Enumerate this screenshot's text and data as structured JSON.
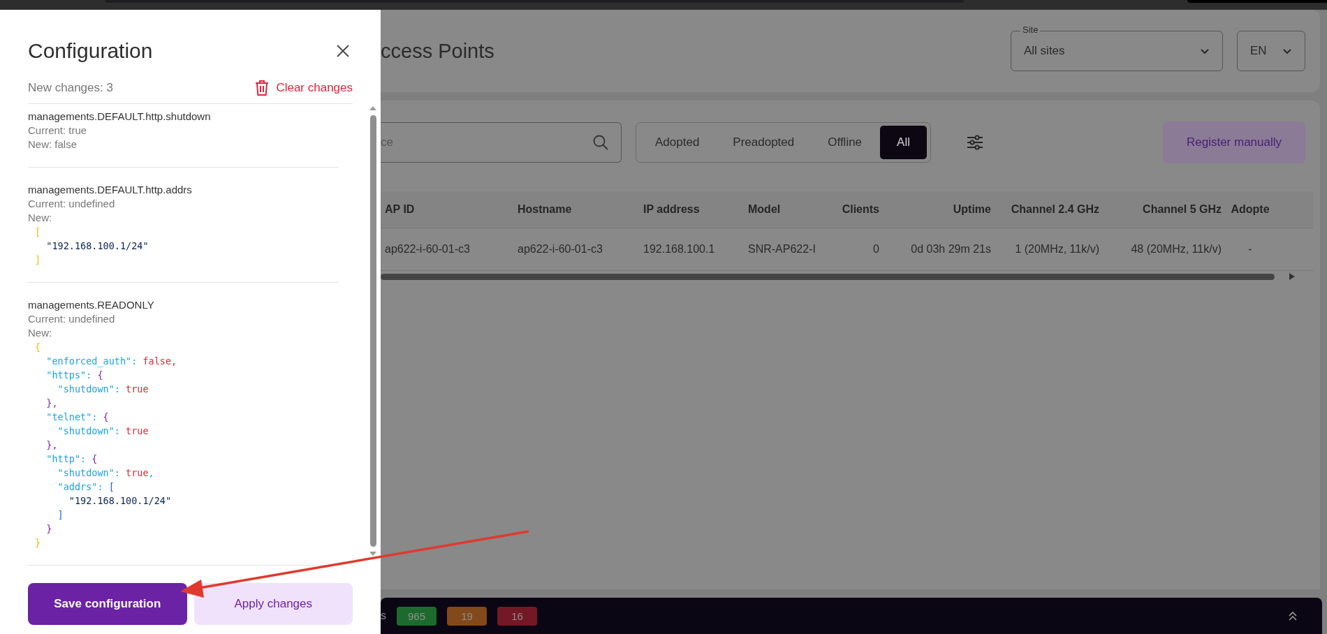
{
  "drawer": {
    "title": "Configuration",
    "new_changes": "New changes: 3",
    "clear": "Clear changes",
    "changes": [
      {
        "path": "managements.DEFAULT.http.shutdown",
        "current": "Current: true",
        "new": "New: false"
      },
      {
        "path": "managements.DEFAULT.http.addrs",
        "current": "Current: undefined",
        "new": "New:",
        "code": [
          [
            {
              "text": "[",
              "kind": "b0"
            }
          ],
          [
            {
              "text": "  \"192.168.100.1/24\"",
              "kind": "str"
            }
          ],
          [
            {
              "text": "]",
              "kind": "b0"
            }
          ]
        ]
      },
      {
        "path": "managements.READONLY",
        "current": "Current: undefined",
        "new": "New:",
        "code": [
          [
            {
              "text": "{",
              "kind": "b0"
            }
          ],
          [
            {
              "text": "  \"enforced_auth\": ",
              "kind": "key"
            },
            {
              "text": "false,",
              "kind": "bool"
            }
          ],
          [
            {
              "text": "  \"https\": ",
              "kind": "key"
            },
            {
              "text": "{",
              "kind": "b1"
            }
          ],
          [
            {
              "text": "    \"shutdown\": ",
              "kind": "key"
            },
            {
              "text": "true",
              "kind": "bool"
            }
          ],
          [
            {
              "text": "  },",
              "kind": "b1"
            }
          ],
          [
            {
              "text": "  \"telnet\": ",
              "kind": "key"
            },
            {
              "text": "{",
              "kind": "b1"
            }
          ],
          [
            {
              "text": "    \"shutdown\": ",
              "kind": "key"
            },
            {
              "text": "true",
              "kind": "bool"
            }
          ],
          [
            {
              "text": "  },",
              "kind": "b1"
            }
          ],
          [
            {
              "text": "  \"http\": ",
              "kind": "key"
            },
            {
              "text": "{",
              "kind": "b1"
            }
          ],
          [
            {
              "text": "    \"shutdown\": ",
              "kind": "key"
            },
            {
              "text": "true",
              "kind": "bool"
            },
            {
              "text": ",",
              "kind": "key"
            }
          ],
          [
            {
              "text": "    \"addrs\": ",
              "kind": "key"
            },
            {
              "text": "[",
              "kind": "b2"
            }
          ],
          [
            {
              "text": "      \"192.168.100.1/24\"",
              "kind": "str"
            }
          ],
          [
            {
              "text": "    ]",
              "kind": "b2"
            }
          ],
          [
            {
              "text": "  }",
              "kind": "b1"
            }
          ],
          [
            {
              "text": "}",
              "kind": "b0"
            }
          ]
        ]
      }
    ],
    "buttons": [
      {
        "label": "Save configuration",
        "kind": "primary"
      },
      {
        "label": "Apply changes",
        "kind": "secondary"
      }
    ]
  },
  "page": {
    "title": "ccess Points",
    "site": {
      "legend": "Site",
      "value": "All sites"
    },
    "language": "EN",
    "search": {
      "placeholder": "ce"
    },
    "filters": [
      {
        "label": "Adopted",
        "selected": false
      },
      {
        "label": "Preadopted",
        "selected": false
      },
      {
        "label": "Offline",
        "selected": false
      },
      {
        "label": "All",
        "selected": true
      }
    ],
    "register": "Register manually",
    "table": {
      "columns": [
        "AP ID",
        "Hostname",
        "IP address",
        "Model",
        "Clients",
        "Uptime",
        "Channel 2.4 GHz",
        "Channel 5 GHz",
        "Adopte"
      ],
      "rows": [
        [
          "ap622-i-60-01-c3",
          "ap622-i-60-01-c3",
          "192.168.100.1",
          "SNR-AP622-I",
          "0",
          "0d 03h 29m 21s",
          "1 (20MHz, 11k/v)",
          "48 (20MHz, 11k/v)",
          "-"
        ]
      ]
    }
  },
  "status_bar": {
    "label": "s",
    "counts": [
      {
        "value": "965",
        "color": "#1d6b2c"
      },
      {
        "value": "19",
        "color": "#83491a"
      },
      {
        "value": "16",
        "color": "#741826"
      }
    ]
  }
}
